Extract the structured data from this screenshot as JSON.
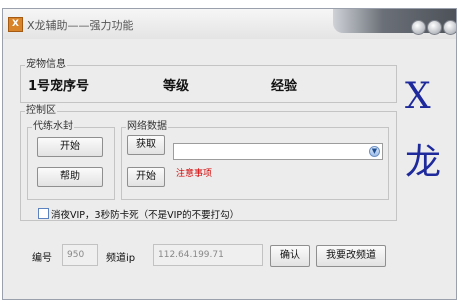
{
  "window": {
    "icon_glyph": "X",
    "title": "X龙辅助——强力功能"
  },
  "side_logo": {
    "char1": "X",
    "char2": "龙"
  },
  "pet_info": {
    "legend": "宠物信息",
    "headers": [
      "1号宠序号",
      "等级",
      "经验"
    ]
  },
  "control": {
    "legend": "控制区",
    "seal_group": {
      "legend": "代练水封",
      "start_label": "开始",
      "help_label": "帮助"
    },
    "network_group": {
      "legend": "网络数据",
      "fetch_label": "获取",
      "start_label": "开始",
      "combo_value": "",
      "combo_icon": "chevron-down-icon",
      "notice": "注意事项"
    }
  },
  "vip_checkbox": {
    "checked": false,
    "label": "消夜VIP，3秒防卡死（不是VIP的不要打勾）"
  },
  "bottom": {
    "id_label": "编号",
    "id_value": "950",
    "channel_label": "频道ip",
    "channel_value": "112.64.199.71",
    "confirm_label": "确认",
    "change_channel_label": "我要改频道"
  },
  "colors": {
    "logo": "#1e2a9c",
    "notice": "#d40000",
    "accent": "#d8842a"
  }
}
